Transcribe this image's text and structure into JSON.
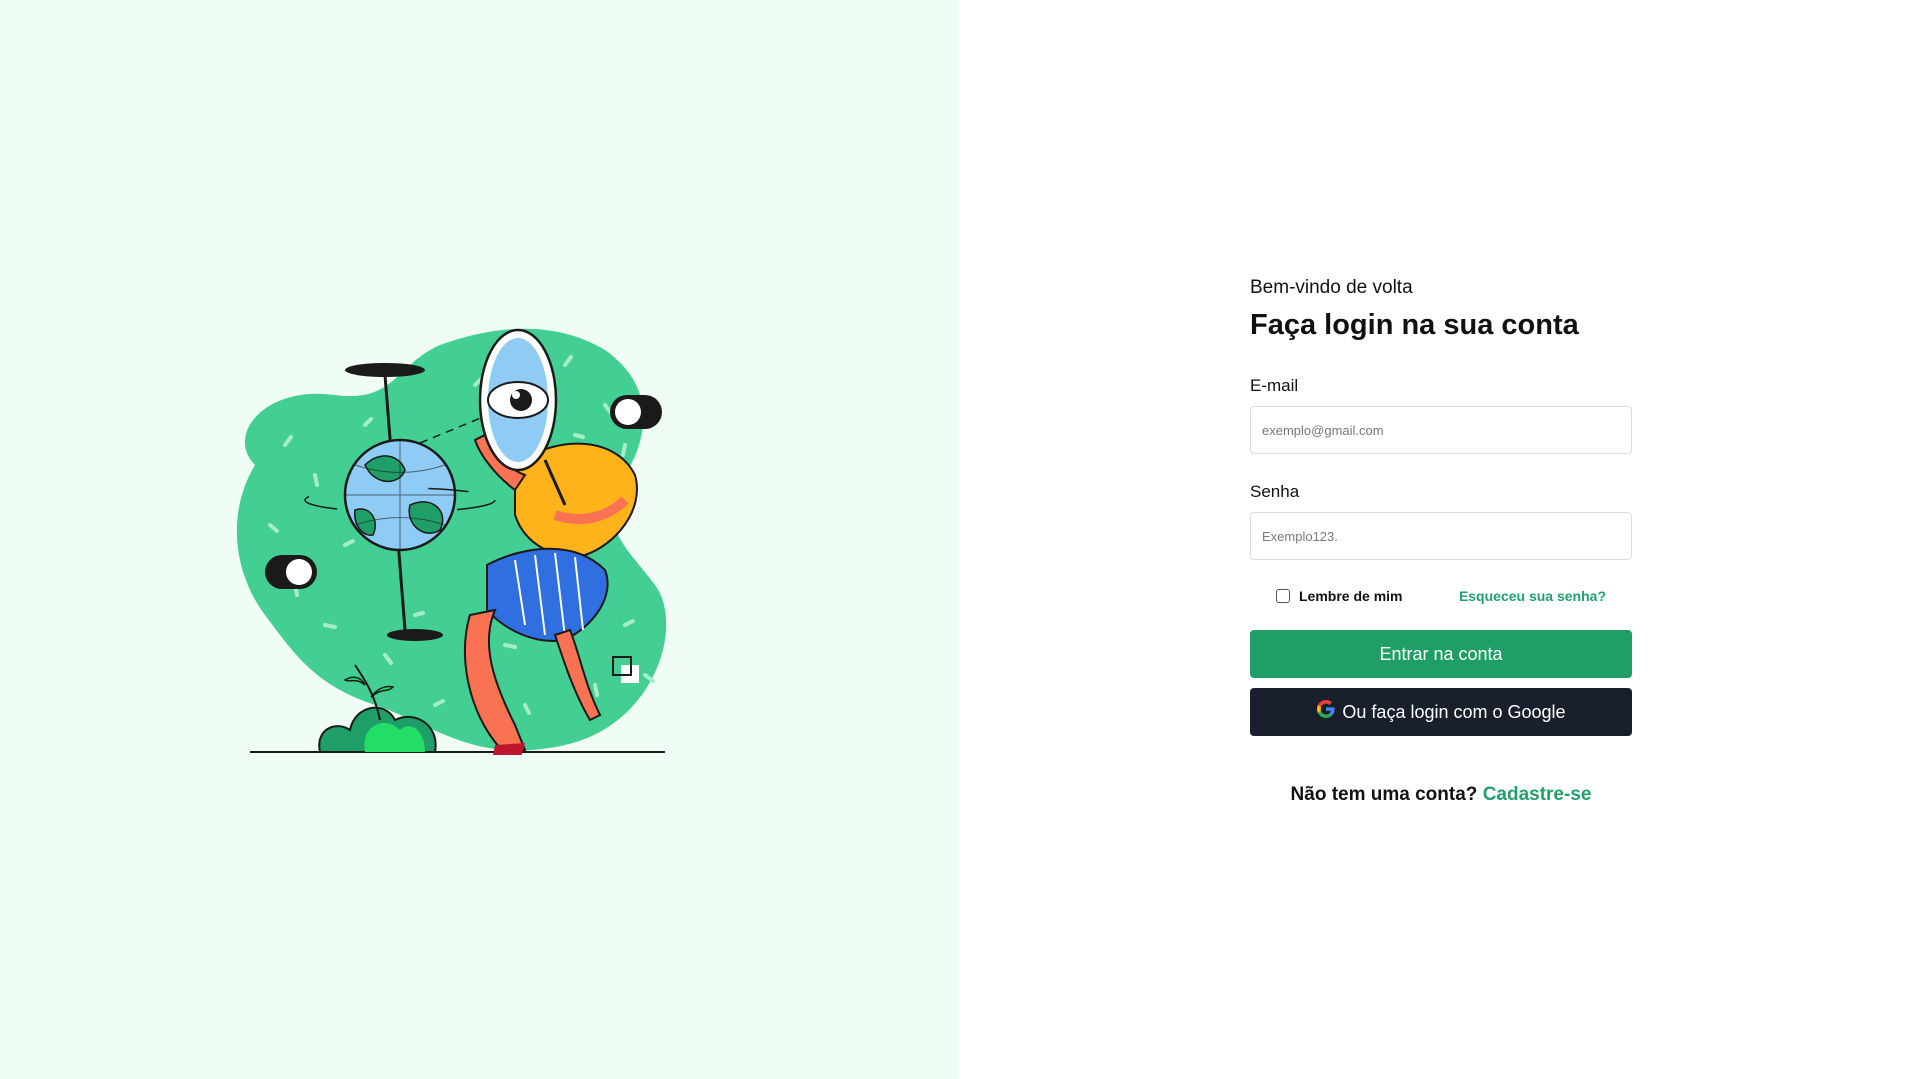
{
  "colors": {
    "left_bg": "#f0fdf4",
    "accent_green": "#1f9e68",
    "link_green": "#22a06b",
    "dark_button": "#19202b"
  },
  "hero": {
    "illustration": "person-holding-mirror-with-globe-illustration"
  },
  "login": {
    "welcome": "Bem-vindo de volta",
    "title": "Faça login na sua conta",
    "email_label": "E-mail",
    "email_placeholder": "exemplo@gmail.com",
    "email_value": "",
    "password_label": "Senha",
    "password_placeholder": "Exemplo123.",
    "password_value": "",
    "remember_label": "Lembre de mim",
    "remember_checked": false,
    "forgot_link": "Esqueceu sua senha?",
    "submit_label": "Entrar na conta",
    "google_label": "Ou faça login com o Google",
    "google_icon": "google-g-icon",
    "no_account_text": "Não tem uma conta?",
    "signup_link": "Cadastre-se"
  }
}
